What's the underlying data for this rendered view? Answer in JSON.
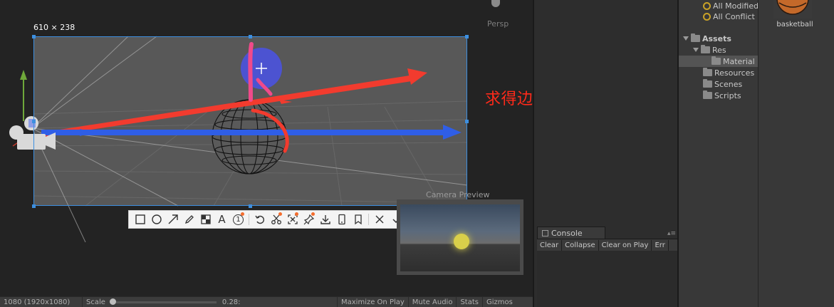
{
  "scene": {
    "camera_mode": "Persp",
    "capture_size": "610 × 238",
    "annotation": "求得边缘光强度的大致演示图",
    "camera_preview_title": "Camera Preview"
  },
  "capture_toolbar": {
    "tools": [
      {
        "name": "rectangle-tool",
        "icon": "rectangle-icon"
      },
      {
        "name": "ellipse-tool",
        "icon": "ellipse-icon"
      },
      {
        "name": "arrow-tool",
        "icon": "arrow-icon"
      },
      {
        "name": "pen-tool",
        "icon": "pencil-icon"
      },
      {
        "name": "mosaic-tool",
        "icon": "mosaic-icon"
      },
      {
        "name": "text-tool",
        "icon": "text-icon",
        "glyph": "A"
      },
      {
        "name": "number-tool",
        "icon": "number-icon",
        "glyph": "1"
      }
    ],
    "done_label": "完成"
  },
  "status_bar": {
    "resolution": "1080 (1920x1080)",
    "scale_label": "Scale",
    "scale_value": "0.28:",
    "maximize": "Maximize On Play",
    "mute": "Mute Audio",
    "stats": "Stats",
    "gizmos": "Gizmos"
  },
  "console": {
    "tab_label": "Console",
    "buttons": [
      "Clear",
      "Collapse",
      "Clear on Play",
      "Err"
    ]
  },
  "project": {
    "tree": [
      {
        "label": "All Modified",
        "type": "search"
      },
      {
        "label": "All Conflict",
        "type": "search"
      },
      {
        "label": "Assets",
        "type": "folder-open"
      },
      {
        "label": "Res",
        "type": "folder-open"
      },
      {
        "label": "Material",
        "type": "folder"
      },
      {
        "label": "Resources",
        "type": "folder"
      },
      {
        "label": "Scenes",
        "type": "folder"
      },
      {
        "label": "Scripts",
        "type": "folder"
      }
    ],
    "asset_label": "basketball"
  },
  "colors": {
    "selection_blue": "#3d8fe0",
    "annotation_red": "#ff2a1a",
    "arrow_red": "#f23b2e",
    "arrow_blue": "#2f5ee6",
    "toolbar_dot": "#f46d2e"
  }
}
